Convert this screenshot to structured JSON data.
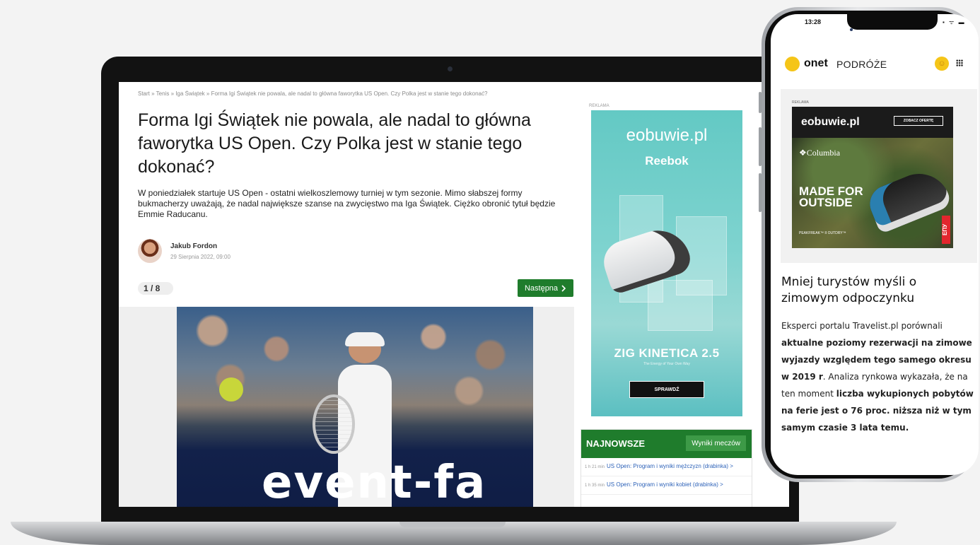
{
  "laptop": {
    "breadcrumb": [
      "Start",
      "Tenis",
      "Iga Świątek",
      "Forma Igi Świątek nie powala, ale nadal to główna faworytka US Open. Czy Polka jest w stanie tego dokonać?"
    ],
    "breadcrumb_separator": "»",
    "article": {
      "title": "Forma Igi Świątek nie powala, ale nadal to główna faworytka US Open. Czy Polka jest w stanie tego dokonać?",
      "lead": "W poniedziałek startuje US Open - ostatni wielkoszlemowy turniej w tym sezonie. Mimo słabszej formy bukmacherzy uważają, że nadal największe szanse na zwycięstwo ma Iga Świątek. Ciężko obronić tytuł będzie Emmie Raducanu.",
      "author_name": "Jakub Fordon",
      "author_date": "29 Sierpnia 2022, 09:00",
      "gallery_counter": "1 / 8",
      "next_label": "Następna",
      "next_icon": "chevron-right-icon",
      "photo_text": "event-fa"
    },
    "ad": {
      "label": "REKLAMA",
      "brand": "eobuwie.pl",
      "sub_brand": "Reebok",
      "product": "ZIG KINETICA 2.5",
      "tagline": "The Energy of Your Own Way",
      "cta": "SPRAWDŹ"
    },
    "news": {
      "title": "NAJNOWSZE",
      "results_button": "Wyniki meczów",
      "items": [
        {
          "time": "1 h 21 min",
          "text": "US Open: Program i wyniki mężczyzn (drabinka) >"
        },
        {
          "time": "1 h 35 min",
          "text": "US Open: Program i wyniki kobiet (drabinka) >"
        }
      ]
    }
  },
  "phone": {
    "status_time": "13:28",
    "status_icons": "▪ ᯤ ▬",
    "header": {
      "logo": "onet",
      "section": "PODRÓŻE"
    },
    "ad": {
      "label": "REKLAMA",
      "brand": "eobuwie.pl",
      "cta": "ZOBACZ OFERTĘ",
      "columbia": "❖Columbia",
      "headline": "MADE FOR OUTSIDE",
      "sub": "PEAKFREAK™ II OUTDRY™",
      "badge": "ЕПУ"
    },
    "article": {
      "title": "Mniej turystów myśli o zimowym odpoczynku",
      "body_parts": [
        {
          "text": "Eksperci portalu Travelist.pl porównali ",
          "bold": false
        },
        {
          "text": "aktualne poziomy rezerwacji na zimowe wyjazdy względem tego samego okresu w 2019 r",
          "bold": true
        },
        {
          "text": ". Analiza rynkowa wykazała, że na ten moment ",
          "bold": false
        },
        {
          "text": "liczba wykupionych pobytów na ferie jest o 76 proc. niższa niż w tym samym czasie 3 lata temu.",
          "bold": true
        }
      ]
    }
  },
  "colors": {
    "accent_green": "#1f7c2c",
    "onet_yellow": "#f5c518",
    "ad_teal": "#63c9c4",
    "link_blue": "#2d62b8"
  }
}
